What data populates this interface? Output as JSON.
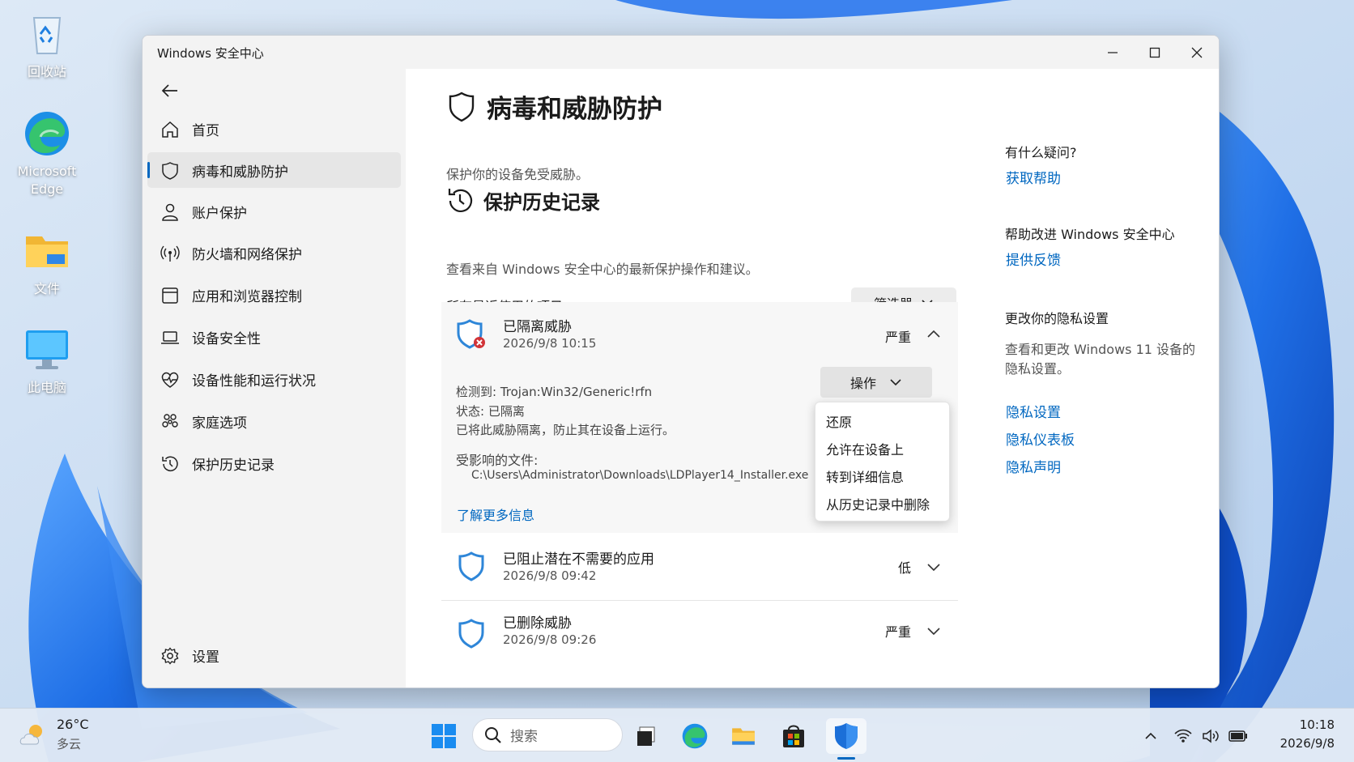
{
  "desktop": {
    "icons": [
      {
        "label": "回收站",
        "icon": "recycle-bin-icon"
      },
      {
        "label": "Microsoft Edge",
        "icon": "edge-icon"
      },
      {
        "label": "文件",
        "icon": "folder-icon"
      },
      {
        "label": "此电脑",
        "icon": "monitor-icon"
      }
    ]
  },
  "window": {
    "title": "Windows 安全中心",
    "controls": [
      "minimize-icon",
      "maximize-icon",
      "close-icon"
    ]
  },
  "sidebar": {
    "back_icon": "back-arrow-icon",
    "items": [
      {
        "label": "首页",
        "icon": "home-icon",
        "active": false
      },
      {
        "label": "病毒和威胁防护",
        "icon": "shield-icon",
        "active": true
      },
      {
        "label": "账户保护",
        "icon": "person-icon",
        "active": false
      },
      {
        "label": "防火墙和网络保护",
        "icon": "antenna-icon",
        "active": false
      },
      {
        "label": "应用和浏览器控制",
        "icon": "app-window-icon",
        "active": false
      },
      {
        "label": "设备安全性",
        "icon": "laptop-icon",
        "active": false
      },
      {
        "label": "设备性能和运行状况",
        "icon": "heart-pulse-icon",
        "active": false
      },
      {
        "label": "家庭选项",
        "icon": "family-icon",
        "active": false
      },
      {
        "label": "保护历史记录",
        "icon": "history-icon",
        "active": false
      }
    ],
    "settings": {
      "label": "设置",
      "icon": "gear-icon"
    }
  },
  "main": {
    "title": "病毒和威胁防护",
    "subtitle": "保护你的设备免受威胁。",
    "section_title": "保护历史记录",
    "section_desc": "查看来自 Windows 安全中心的最新保护操作和建议。",
    "recent_dropdown": "所有最近使用的项目",
    "filter_button": "筛选器",
    "events": [
      {
        "title": "已隔离威胁",
        "date": "2026/9/8 10:15",
        "severity": "严重",
        "expanded": true,
        "detected": "检测到: Trojan:Win32/Generic!rfn",
        "status": "状态: 已隔离",
        "note": "已将此威胁隔离，防止其在设备上运行。",
        "files_label": "受影响的文件:",
        "file_path": "C:\\Users\\Administrator\\Downloads\\LDPlayer14_Installer.exe",
        "learn_more": "了解更多信息",
        "action_button": "操作",
        "action_menu": [
          "还原",
          "允许在设备上",
          "转到详细信息",
          "从历史记录中删除"
        ]
      },
      {
        "title": "已阻止潜在不需要的应用",
        "date": "2026/9/8 09:42",
        "severity": "低",
        "expanded": false
      },
      {
        "title": "已删除威胁",
        "date": "2026/9/8 09:26",
        "severity": "严重",
        "expanded": false
      }
    ]
  },
  "right_panel": {
    "question_title": "有什么疑问?",
    "get_help": "获取帮助",
    "improve_title": "帮助改进 Windows 安全中心",
    "feedback": "提供反馈",
    "privacy_title": "更改你的隐私设置",
    "privacy_desc": "查看和更改 Windows 11 设备的隐私设置。",
    "privacy_links": [
      "隐私设置",
      "隐私仪表板",
      "隐私声明"
    ]
  },
  "taskbar": {
    "weather_temp": "26°C",
    "weather_desc": "多云",
    "search_placeholder": "搜索",
    "apps": [
      "start-icon",
      "task-view-icon",
      "edge-icon",
      "file-explorer-icon",
      "store-icon",
      "windows-security-icon"
    ],
    "time": "10:18",
    "date": "2026/9/8"
  },
  "colors": {
    "accent": "#0067c0",
    "shield_blue": "#2e86d8",
    "threat_red": "#d13438",
    "sidebar_bg": "#f3f3f3"
  }
}
